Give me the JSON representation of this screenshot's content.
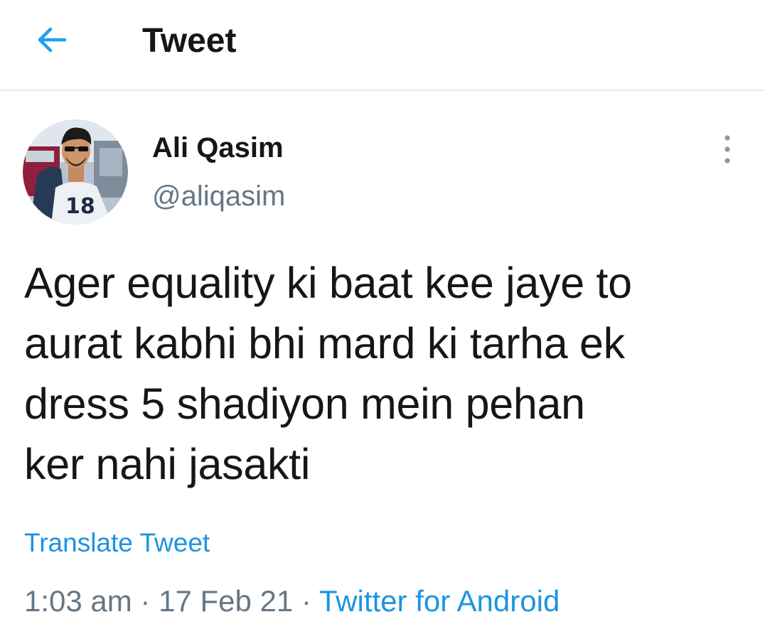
{
  "header": {
    "title": "Tweet",
    "back_icon": "arrow-left-icon",
    "accent_color": "#1da1f2"
  },
  "author": {
    "name": "Ali Qasim",
    "handle": "@aliqasim",
    "avatar_icon": "profile-photo"
  },
  "more_icon": "vertical-ellipsis-icon",
  "tweet": {
    "text_lines": [
      "Ager equality ki baat kee jaye to",
      "aurat kabhi bhi mard ki tarha ek",
      "dress 5 shadiyon mein pehan",
      "ker nahi jasakti"
    ],
    "translate_label": "Translate Tweet"
  },
  "meta": {
    "time": "1:03 am",
    "separator": " · ",
    "date": "17 Feb 21",
    "source": "Twitter for Android"
  },
  "colors": {
    "link": "#1b95e0",
    "secondary_text": "#657786",
    "primary_text": "#14171a",
    "divider": "#e6ecf0"
  }
}
